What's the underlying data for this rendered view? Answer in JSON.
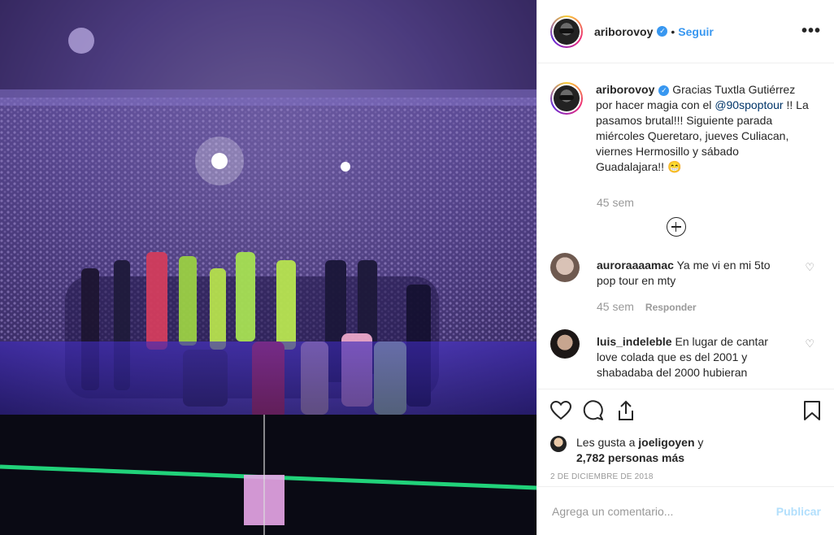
{
  "post": {
    "author": "ariborovoy",
    "follow_label": "Seguir",
    "more_label": "•••",
    "verified_glyph": "✓",
    "photo_name": "concert-stage-photo"
  },
  "caption": {
    "author": "ariborovoy",
    "text_before": "Gracias Tuxtla Gutiérrez por hacer magia con el ",
    "mention": "@90spoptour",
    "text_after": " !! La pasamos brutal!!! Siguiente parada miércoles Queretaro, jueves Culiacan, viernes Hermosillo y sábado Guadalajara!! 😁",
    "time": "45 sem"
  },
  "comments": [
    {
      "user": "auroraaaamac",
      "text": "Ya me vi en mi 5to pop tour en mty",
      "time": "45 sem",
      "reply": "Responder"
    },
    {
      "user": "luis_indeleble",
      "text": "En lugar de cantar love colada que es del 2001 y shabadaba del 2000 hubieran",
      "time": "",
      "reply": ""
    }
  ],
  "likes": {
    "prefix": "Les gusta a ",
    "user": "joeligoyen",
    "connector": " y",
    "count": "2,782 personas más"
  },
  "date": "2 DE DICIEMBRE DE 2018",
  "composer": {
    "placeholder": "Agrega un comentario...",
    "publish_label": "Publicar"
  },
  "colors": {
    "accent": "#3897f0",
    "publish_disabled": "#b2dffc",
    "muted": "#999999"
  }
}
